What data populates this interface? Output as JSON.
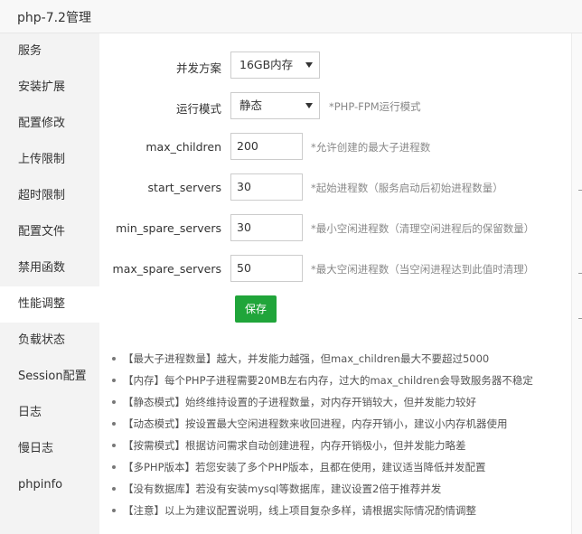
{
  "window": {
    "title": "php-7.2管理"
  },
  "sidebar": {
    "items": [
      {
        "label": "服务"
      },
      {
        "label": "安装扩展"
      },
      {
        "label": "配置修改"
      },
      {
        "label": "上传限制"
      },
      {
        "label": "超时限制"
      },
      {
        "label": "配置文件"
      },
      {
        "label": "禁用函数"
      },
      {
        "label": "性能调整",
        "active": true
      },
      {
        "label": "负载状态"
      },
      {
        "label": "Session配置"
      },
      {
        "label": "日志"
      },
      {
        "label": "慢日志"
      },
      {
        "label": "phpinfo"
      }
    ]
  },
  "form": {
    "concurrency": {
      "label": "并发方案",
      "value": "16GB内存"
    },
    "mode": {
      "label": "运行模式",
      "value": "静态",
      "hint": "*PHP-FPM运行模式"
    },
    "max_children": {
      "label": "max_children",
      "value": "200",
      "hint": "*允许创建的最大子进程数"
    },
    "start_servers": {
      "label": "start_servers",
      "value": "30",
      "hint": "*起始进程数（服务启动后初始进程数量）"
    },
    "min_spare_servers": {
      "label": "min_spare_servers",
      "value": "30",
      "hint": "*最小空闲进程数（清理空闲进程后的保留数量）"
    },
    "max_spare_servers": {
      "label": "max_spare_servers",
      "value": "50",
      "hint": "*最大空闲进程数（当空闲进程达到此值时清理）"
    },
    "save_label": "保存"
  },
  "notes": [
    "【最大子进程数量】越大，并发能力越强，但max_children最大不要超过5000",
    "【内存】每个PHP子进程需要20MB左右内存，过大的max_children会导致服务器不稳定",
    "【静态模式】始终维持设置的子进程数量，对内存开销较大，但并发能力较好",
    "【动态模式】按设置最大空闲进程数来收回进程，内存开销小，建议小内存机器使用",
    "【按需模式】根据访问需求自动创建进程，内存开销极小，但并发能力略差",
    "【多PHP版本】若您安装了多个PHP版本，且都在使用，建议适当降低并发配置",
    "【没有数据库】若没有安装mysql等数据库，建议设置2倍于推荐并发",
    "【注意】以上为建议配置说明，线上项目复杂多样，请根据实际情况酌情调整"
  ],
  "colors": {
    "accent": "#20a53a",
    "sidebar_bg": "#f3f3f3",
    "hint_text": "#888888"
  }
}
